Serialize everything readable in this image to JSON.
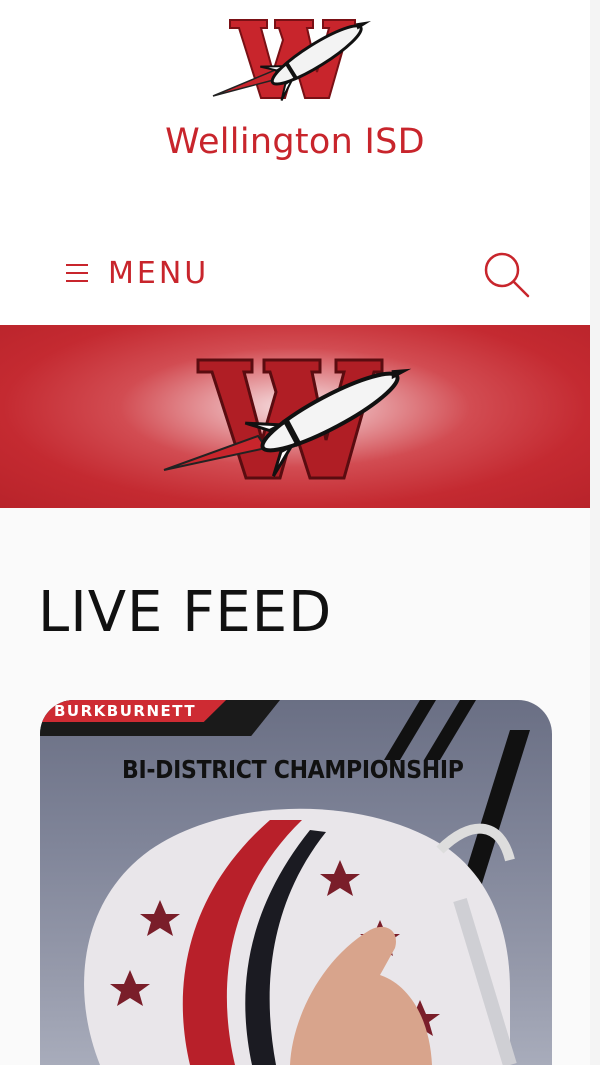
{
  "header": {
    "school_name": "Wellington ISD",
    "menu_label": "MENU"
  },
  "icons": {
    "menu": "hamburger-icon",
    "search": "search-icon",
    "logo": "rocket-w-logo"
  },
  "colors": {
    "brand_red": "#c8252c",
    "banner_red": "#c42a31"
  },
  "feed": {
    "title": "LIVE FEED",
    "cards": [
      {
        "tag": "BURKBURNETT",
        "headline": "BI-DISTRICT CHAMPIONSHIP"
      }
    ]
  }
}
